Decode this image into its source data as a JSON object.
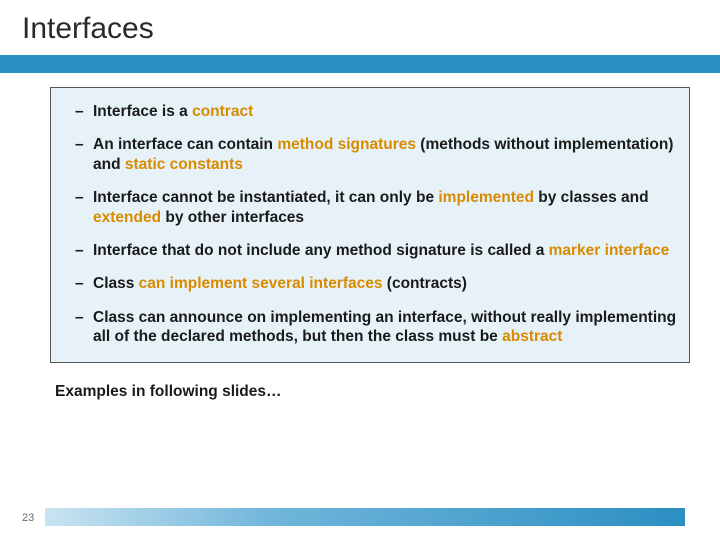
{
  "title": "Interfaces",
  "bullets": [
    {
      "pre": "Interface is a ",
      "h1": "contract",
      "post": ""
    },
    {
      "pre": "An interface can contain ",
      "h1": "method signatures",
      "mid": " (methods without implementation) and ",
      "h2": "static constants",
      "post": ""
    },
    {
      "pre": "Interface cannot be instantiated, it can only be ",
      "h1": "implemented",
      "mid": " by classes and ",
      "h2": "extended",
      "post": " by other interfaces"
    },
    {
      "pre": "Interface that do not include any method signature is called a ",
      "h1": "marker interface",
      "post": ""
    },
    {
      "pre": "Class ",
      "h1": "can implement several interfaces",
      "post": " (contracts)"
    },
    {
      "pre": "Class can announce on implementing an interface, without really implementing all of the declared methods, but then the class must be ",
      "h1": "abstract",
      "post": ""
    }
  ],
  "footer_note": "Examples in following slides…",
  "page_number": "23"
}
